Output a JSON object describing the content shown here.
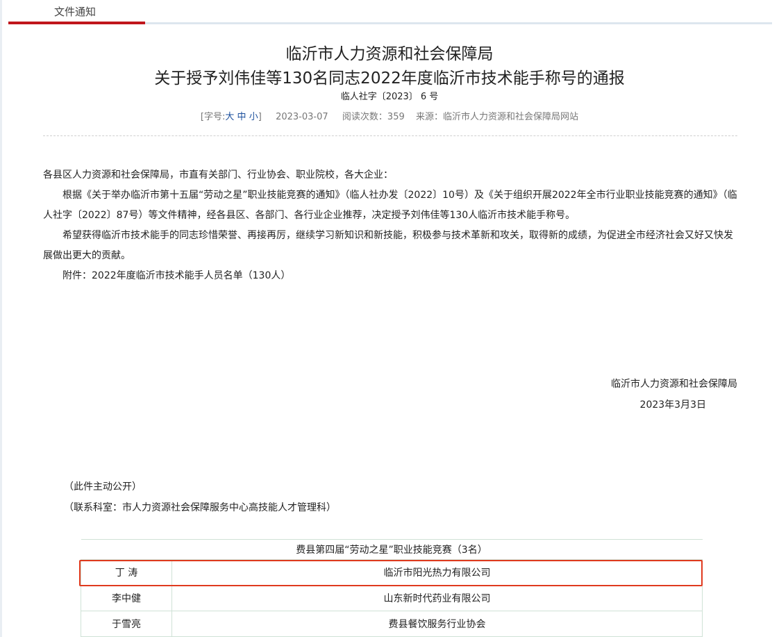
{
  "tab": {
    "label": "文件通知"
  },
  "header": {
    "title_line1": "临沂市人力资源和社会保障局",
    "title_line2": "关于授予刘伟佳等130名同志2022年度临沂市技术能手称号的通报",
    "doc_number": "临人社字〔2023〕 6 号"
  },
  "meta": {
    "font_prefix": "[字号:",
    "font_large": "大",
    "font_medium": "中",
    "font_small": "小",
    "font_suffix": "]",
    "date": "2023-03-07",
    "reads_label": "阅读次数：",
    "reads": "359",
    "source_label": "来源：",
    "source": "临沂市人力资源和社会保障局网站"
  },
  "body": {
    "salutation": "各县区人力资源和社会保障局，市直有关部门、行业协会、职业院校，各大企业：",
    "para1": "根据《关于举办临沂市第十五届“劳动之星”职业技能竞赛的通知》（临人社办发〔2022〕10号）及《关于组织开展2022年全市行业职业技能竞赛的通知》（临人社字〔2022〕87号）等文件精神，经各县区、各部门、各行业企业推荐，决定授予刘伟佳等130人临沂市技术能手称号。",
    "para2": "希望获得临沂市技术能手的同志珍惜荣誉、再接再厉，继续学习新知识和新技能，积极参与技术革新和攻关，取得新的成绩，为促进全市经济社会又好又快发展做出更大的贡献。",
    "attachment": "附件：2022年度临沂市技术能手人员名单（130人）"
  },
  "signature": {
    "org": "临沂市人力资源和社会保障局",
    "date": "2023年3月3日"
  },
  "notes": {
    "public": "（此件主动公开）",
    "contact": "（联系科室：市人力资源社会保障服务中心高技能人才管理科）"
  },
  "table": {
    "header": "费县第四届“劳动之星”职业技能竞赛（3名）",
    "rows": [
      {
        "name": "丁  涛",
        "org": "临沂市阳光热力有限公司"
      },
      {
        "name": "李中健",
        "org": "山东新时代药业有限公司"
      },
      {
        "name": "于雪亮",
        "org": "费县餐饮服务行业协会"
      }
    ]
  },
  "colors": {
    "accent_red": "#c0161c",
    "highlight": "#e03a1e",
    "link_blue": "#1b4f9c"
  }
}
